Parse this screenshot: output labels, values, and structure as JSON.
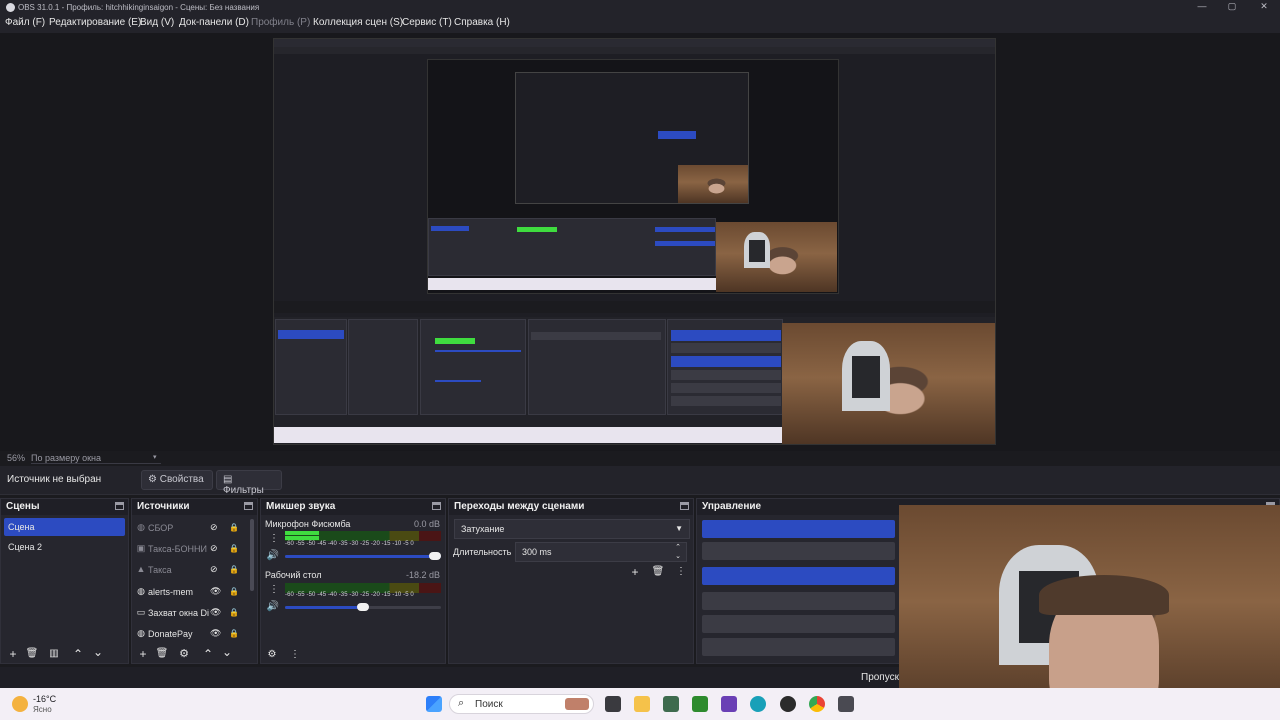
{
  "window": {
    "title": "OBS 31.0.1 - Профиль: hitchhikinginsaigon - Сцены: Без названия",
    "minimize": "—",
    "maximize": "▢",
    "close": "✕"
  },
  "menu": [
    {
      "label": "Файл (F)",
      "enabled": true
    },
    {
      "label": "Редактирование (E)",
      "enabled": true
    },
    {
      "label": "Вид (V)",
      "enabled": true
    },
    {
      "label": "Док-панели (D)",
      "enabled": true
    },
    {
      "label": "Профиль (P)",
      "enabled": false
    },
    {
      "label": "Коллекция сцен (S)",
      "enabled": true
    },
    {
      "label": "Сервис (T)",
      "enabled": true
    },
    {
      "label": "Справка (H)",
      "enabled": true
    }
  ],
  "preview": {
    "zoom": "56%",
    "fit_mode": "По размеру окна"
  },
  "context": {
    "no_source": "Источник не выбран",
    "properties": "Свойства",
    "filters": "Фильтры"
  },
  "scenes": {
    "title": "Сцены",
    "items": [
      {
        "label": "Сцена",
        "selected": true
      },
      {
        "label": "Сцена 2",
        "selected": false
      }
    ]
  },
  "sources": {
    "title": "Источники",
    "items": [
      {
        "label": "СБОР",
        "icon": "browser-icon",
        "visible": false
      },
      {
        "label": "Такса-БОННИ",
        "icon": "image-icon",
        "visible": false
      },
      {
        "label": "Такса",
        "icon": "image-icon",
        "visible": false
      },
      {
        "label": "alerts-mem",
        "icon": "browser-icon",
        "visible": true
      },
      {
        "label": "Захват окна Di",
        "icon": "window-capture-icon",
        "visible": true
      },
      {
        "label": "DonatePay",
        "icon": "browser-icon",
        "visible": true
      }
    ]
  },
  "mixer": {
    "title": "Микшер звука",
    "channels": [
      {
        "name": "Микрофон Фисюмба",
        "db": "0.0 dB",
        "level": 0.22,
        "volume": 1.0
      },
      {
        "name": "Рабочий стол",
        "db": "-18.2 dB",
        "level": 0.0,
        "volume": 0.5
      }
    ],
    "scale": [
      "-60",
      "-55",
      "-50",
      "-45",
      "-40",
      "-35",
      "-30",
      "-25",
      "-20",
      "-15",
      "-10",
      "-5",
      "0"
    ]
  },
  "transitions": {
    "title": "Переходы между сценами",
    "selected": "Затухание",
    "duration_label": "Длительность",
    "duration_value": "300 ms"
  },
  "controls": {
    "title": "Управление",
    "partial_label": "Пропуск"
  },
  "taskbar": {
    "weather_temp": "-16°C",
    "weather_text": "Ясно",
    "search_placeholder": "Поиск"
  },
  "colors": {
    "accent": "#2c4bc1",
    "background": "#1b1b1f",
    "dock": "#26262e",
    "meter_green": "#3fdc3f"
  }
}
